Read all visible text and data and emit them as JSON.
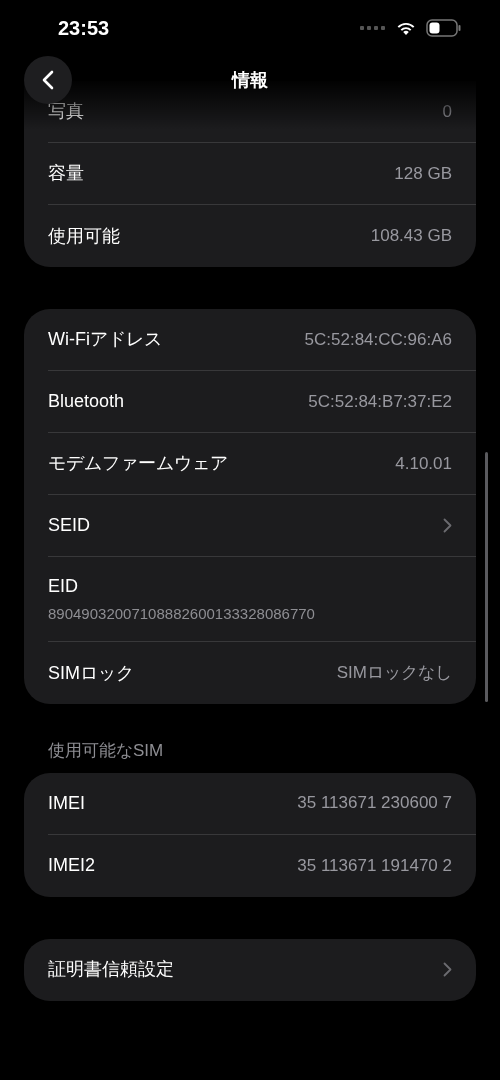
{
  "status_bar": {
    "time": "23:53"
  },
  "nav": {
    "title": "情報"
  },
  "groups": [
    {
      "rows": [
        {
          "kind": "value",
          "label": "写真",
          "value": "0"
        },
        {
          "kind": "value",
          "label": "容量",
          "value": "128 GB"
        },
        {
          "kind": "value",
          "label": "使用可能",
          "value": "108.43 GB"
        }
      ]
    },
    {
      "rows": [
        {
          "kind": "value",
          "label": "Wi-Fiアドレス",
          "value": "5C:52:84:CC:96:A6"
        },
        {
          "kind": "value",
          "label": "Bluetooth",
          "value": "5C:52:84:B7:37:E2"
        },
        {
          "kind": "value",
          "label": "モデムファームウェア",
          "value": "4.10.01"
        },
        {
          "kind": "link",
          "label": "SEID"
        },
        {
          "kind": "stacked",
          "label": "EID",
          "value": "89049032007108882600133328086770"
        },
        {
          "kind": "value",
          "label": "SIMロック",
          "value": "SIMロックなし"
        }
      ]
    },
    {
      "header": "使用可能なSIM",
      "rows": [
        {
          "kind": "value",
          "label": "IMEI",
          "value": "35 113671 230600 7"
        },
        {
          "kind": "value",
          "label": "IMEI2",
          "value": "35 113671 191470 2"
        }
      ]
    },
    {
      "rows": [
        {
          "kind": "link",
          "label": "証明書信頼設定"
        }
      ]
    }
  ]
}
